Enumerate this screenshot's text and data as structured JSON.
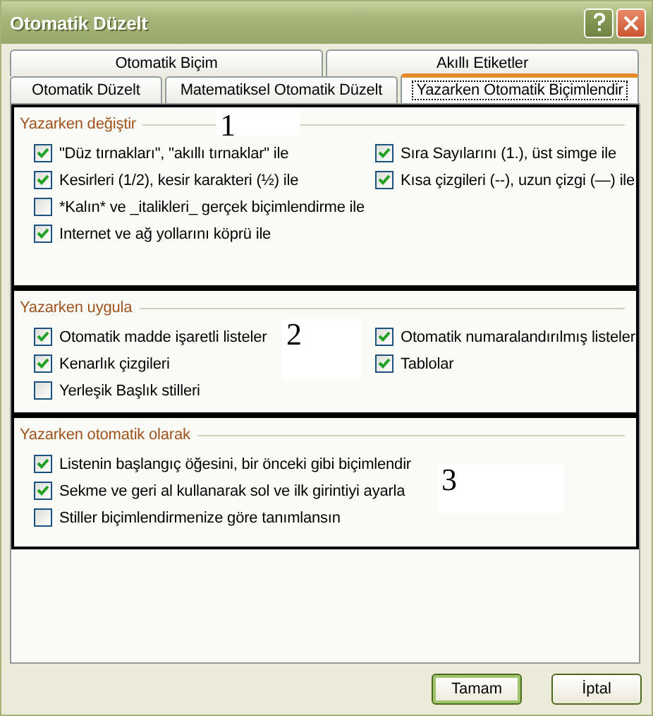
{
  "window": {
    "title": "Otomatik Düzelt"
  },
  "tab_rows": [
    {
      "tabs": [
        {
          "label": "Otomatik Biçim",
          "selected": false
        },
        {
          "label": "Akıllı Etiketler",
          "selected": false
        }
      ]
    },
    {
      "tabs": [
        {
          "label": "Otomatik Düzelt",
          "selected": false
        },
        {
          "label": "Matematiksel Otomatik Düzelt",
          "selected": false
        },
        {
          "label": "Yazarken Otomatik Biçimlendir",
          "selected": true
        }
      ]
    }
  ],
  "sections": [
    {
      "title": "Yazarken değiştir",
      "annotation": "1",
      "columns": [
        {
          "items": [
            {
              "label": "\"Düz tırnakları\", \"akıllı tırnaklar\" ile",
              "checked": true
            },
            {
              "label": "Kesirleri (1/2), kesir karakteri (½) ile",
              "checked": true
            },
            {
              "label": "*Kalın* ve _italikleri_ gerçek biçimlendirme ile",
              "checked": false
            },
            {
              "label": "Internet ve ağ yollarını köprü ile",
              "checked": true
            }
          ]
        },
        {
          "items": [
            {
              "label": "Sıra Sayılarını (1.), üst simge ile",
              "checked": true
            },
            {
              "label": "Kısa çizgileri (--), uzun çizgi (—) ile",
              "checked": true
            }
          ]
        }
      ]
    },
    {
      "title": "Yazarken uygula",
      "annotation": "2",
      "columns": [
        {
          "items": [
            {
              "label": "Otomatik madde işaretli listeler",
              "checked": true
            },
            {
              "label": "Kenarlık çizgileri",
              "checked": true
            },
            {
              "label": "Yerleşik Başlık stilleri",
              "checked": false
            }
          ]
        },
        {
          "items": [
            {
              "label": "Otomatik numaralandırılmış listeler",
              "checked": true
            },
            {
              "label": "Tablolar",
              "checked": true
            }
          ]
        }
      ]
    },
    {
      "title": "Yazarken otomatik olarak",
      "annotation": "3",
      "columns": [
        {
          "items": [
            {
              "label": "Listenin başlangıç öğesini, bir önceki gibi biçimlendir",
              "checked": true
            },
            {
              "label": "Sekme ve geri al kullanarak sol ve ilk girintiyi ayarla",
              "checked": true
            },
            {
              "label": "Stiller biçimlendirmenize göre tanımlansın",
              "checked": false
            }
          ]
        }
      ]
    }
  ],
  "buttons": [
    {
      "label": "Tamam",
      "default": true
    },
    {
      "label": "İptal",
      "default": false
    }
  ]
}
